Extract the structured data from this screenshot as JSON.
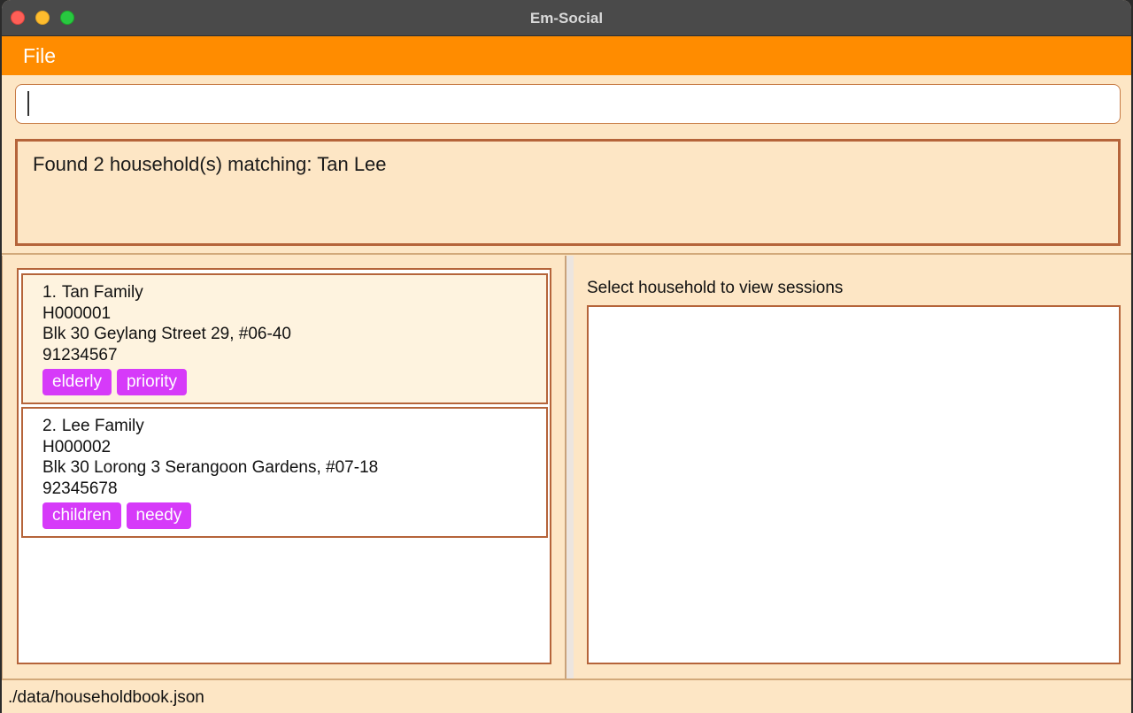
{
  "window": {
    "title": "Em-Social"
  },
  "menu": {
    "file": "File"
  },
  "command": {
    "value": "",
    "placeholder": ""
  },
  "result": {
    "message": "Found 2 household(s) matching: Tan Lee"
  },
  "households": [
    {
      "index": "1.",
      "name": "Tan Family",
      "id": "H000001",
      "address": "Blk 30 Geylang Street 29, #06-40",
      "phone": "91234567",
      "tags": [
        "elderly",
        "priority"
      ]
    },
    {
      "index": "2.",
      "name": "Lee Family",
      "id": "H000002",
      "address": "Blk 30 Lorong 3 Serangoon Gardens, #07-18",
      "phone": "92345678",
      "tags": [
        "children",
        "needy"
      ]
    }
  ],
  "sessions": {
    "label": "Select household to view sessions"
  },
  "status": {
    "path": "./data/householdbook.json"
  },
  "colors": {
    "accent": "#ff8c00",
    "tag": "#d63af9",
    "background": "#fde6c5",
    "border": "#b5643a"
  }
}
